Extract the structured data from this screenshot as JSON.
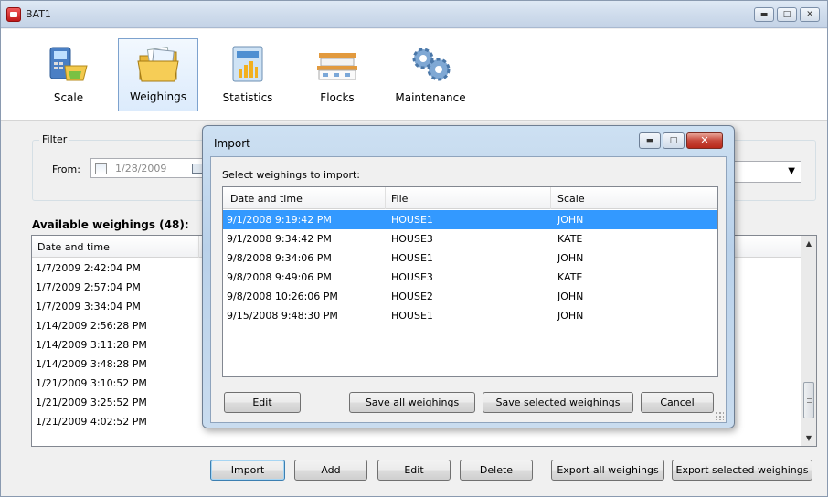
{
  "window": {
    "title": "BAT1",
    "controls": [
      "minimize",
      "maximize",
      "close"
    ]
  },
  "toolbar": {
    "items": [
      {
        "label": "Scale",
        "icon": "scale-icon",
        "selected": false
      },
      {
        "label": "Weighings",
        "icon": "folder-icon",
        "selected": true
      },
      {
        "label": "Statistics",
        "icon": "statistics-icon",
        "selected": false
      },
      {
        "label": "Flocks",
        "icon": "flocks-icon",
        "selected": false
      },
      {
        "label": "Maintenance",
        "icon": "gears-icon",
        "selected": false
      }
    ]
  },
  "filter": {
    "caption": "Filter",
    "from_label": "From:",
    "from_value": "1/28/2009",
    "from_checked": false
  },
  "available": {
    "title": "Available weighings (48):",
    "columns": [
      "Date and time"
    ],
    "rows": [
      "1/7/2009 2:42:04 PM",
      "1/7/2009 2:57:04 PM",
      "1/7/2009 3:34:04 PM",
      "1/14/2009 2:56:28 PM",
      "1/14/2009 3:11:28 PM",
      "1/14/2009 3:48:28 PM",
      "1/21/2009 3:10:52 PM",
      "1/21/2009 3:25:52 PM",
      "1/21/2009 4:02:52 PM"
    ]
  },
  "buttons": {
    "import": "Import",
    "add": "Add",
    "edit": "Edit",
    "delete": "Delete",
    "export_all": "Export all weighings",
    "export_selected": "Export selected weighings"
  },
  "dialog": {
    "title": "Import",
    "instruction": "Select weighings to import:",
    "columns": [
      "Date and time",
      "File",
      "Scale"
    ],
    "rows": [
      {
        "date": "9/1/2008 9:19:42 PM",
        "file": "HOUSE1",
        "scale": "JOHN",
        "selected": true
      },
      {
        "date": "9/1/2008 9:34:42 PM",
        "file": "HOUSE3",
        "scale": "KATE",
        "selected": false
      },
      {
        "date": "9/8/2008 9:34:06 PM",
        "file": "HOUSE1",
        "scale": "JOHN",
        "selected": false
      },
      {
        "date": "9/8/2008 9:49:06 PM",
        "file": "HOUSE3",
        "scale": "KATE",
        "selected": false
      },
      {
        "date": "9/8/2008 10:26:06 PM",
        "file": "HOUSE2",
        "scale": "JOHN",
        "selected": false
      },
      {
        "date": "9/15/2008 9:48:30 PM",
        "file": "HOUSE1",
        "scale": "JOHN",
        "selected": false
      }
    ],
    "buttons": {
      "edit": "Edit",
      "save_all": "Save all weighings",
      "save_selected": "Save selected weighings",
      "cancel": "Cancel"
    }
  },
  "colors": {
    "selection": "#3399ff",
    "toolbar_selected": "#dcebfc",
    "dialog_frame": "#b9d1ea"
  }
}
